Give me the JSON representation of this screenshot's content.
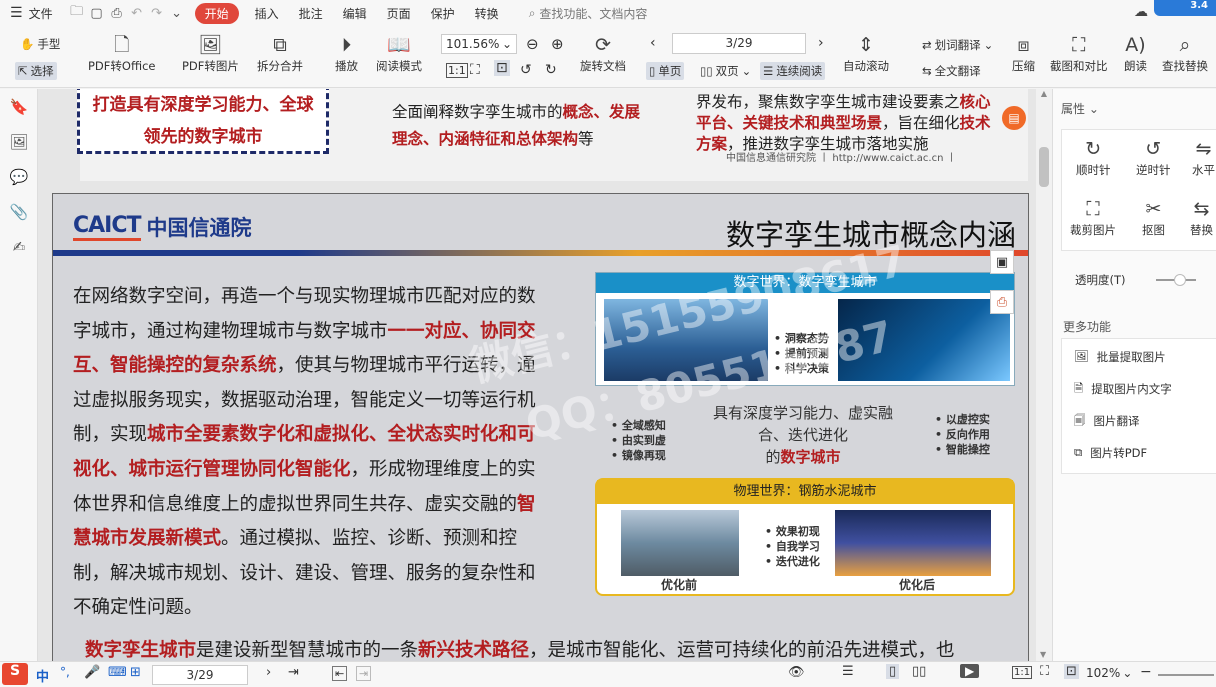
{
  "menu": {
    "file": "文件",
    "tabs": [
      "开始",
      "插入",
      "批注",
      "编辑",
      "页面",
      "保护",
      "转换"
    ],
    "search_placeholder": "查找功能、文档内容",
    "badge": "3.4"
  },
  "ribbon": {
    "hand": "手型",
    "select": "选择",
    "pdf_to_office": "PDF转Office",
    "pdf_to_image": "PDF转图片",
    "split_merge": "拆分合并",
    "play": "播放",
    "read_mode": "阅读模式",
    "zoom": "101.56%",
    "page_input": "3/29",
    "rotate_doc": "旋转文档",
    "single_page": "单页",
    "double_page": "双页",
    "continuous": "连续阅读",
    "auto_scroll": "自动滚动",
    "word_translate": "划词翻译",
    "full_translate": "全文翻译",
    "compress": "压缩",
    "screenshot_compare": "截图和对比",
    "read_aloud": "朗读",
    "find_replace": "查找替换"
  },
  "page1": {
    "left_text": "打造具有深度学习能力、全球领先的数字城市",
    "mid_normal_1": "全面阐释数字孪生城市的",
    "mid_red_1": "概念、发展理念、内涵特征和总体架构",
    "mid_normal_2": "等",
    "right_normal_1": "界发布，聚焦数字孪生城市建设要素之",
    "right_red_1": "核心平台、关键技术和典型场景",
    "right_normal_2": "，旨在细化",
    "right_red_2": "技术方案",
    "right_normal_3": "，推进数字孪生城市落地实施",
    "footer": "中国信息通信研究院 丨 http://www.caict.ac.cn 丨"
  },
  "slide": {
    "logo_en": "CAICT",
    "logo_cn": "中国信通院",
    "title": "数字孪生城市概念内涵",
    "p1": "在网络数字空间，再造一个与现实物理城市匹配对应的数字城市，通过构建物理城市与数字城市",
    "r1": "一一对应、协同交互、智能操控的复杂系统",
    "p2": "，使其与物理城市平行运转，通过虚拟服务现实，数据驱动治理，智能定义一切等运行机制，实现",
    "r2": "城市全要素数字化和虚拟化、全状态实时化和可视化、城市运行管理协同化智能化",
    "p3": "，形成物理维度上的实体世界和信息维度上的虚拟世界同生共存、虚实交融的",
    "r3": "智慧城市发展新模式",
    "p4": "。通过模拟、监控、诊断、预测和控制，解决城市规划、设计、建设、管理、服务的复杂性和不确定性问题。",
    "bottom_r1": "数字孪生城市",
    "bottom_n1": "是建设新型智慧城市的一条",
    "bottom_r2": "新兴技术路径",
    "bottom_n2": "，是城市智能化、运营可持续化的前沿先进模式，也"
  },
  "diagram": {
    "digital_world": "数字世界：数字孪生城市",
    "mid_items": [
      "洞察态势",
      "提前预测",
      "科学决策"
    ],
    "left_items": [
      "全域感知",
      "由实到虚",
      "镜像再现"
    ],
    "right_items": [
      "以虚控实",
      "反向作用",
      "智能操控"
    ],
    "center_line1": "具有深度学习能力、虚实融",
    "center_line2": "合、迭代进化",
    "center_line3a": "的",
    "center_line3b": "数字城市",
    "physical_world": "物理世界：钢筋水泥城市",
    "bottom_items": [
      "效果初现",
      "自我学习",
      "迭代进化"
    ],
    "before": "优化前",
    "after": "优化后"
  },
  "watermark": {
    "line1": "微信：15155908617",
    "line2": "QQ：805516687"
  },
  "right_panel": {
    "properties": "属性",
    "clockwise": "顺时针",
    "counter": "逆时针",
    "horizontal": "水平",
    "crop": "裁剪图片",
    "cutout": "抠图",
    "replace": "替换",
    "transparency": "透明度(T)",
    "more": "更多功能",
    "batch_extract": "批量提取图片",
    "extract_text": "提取图片内文字",
    "image_translate": "图片翻译",
    "image_to_pdf": "图片转PDF"
  },
  "status": {
    "ime": "中",
    "page": "3/29",
    "zoom": "102%"
  }
}
